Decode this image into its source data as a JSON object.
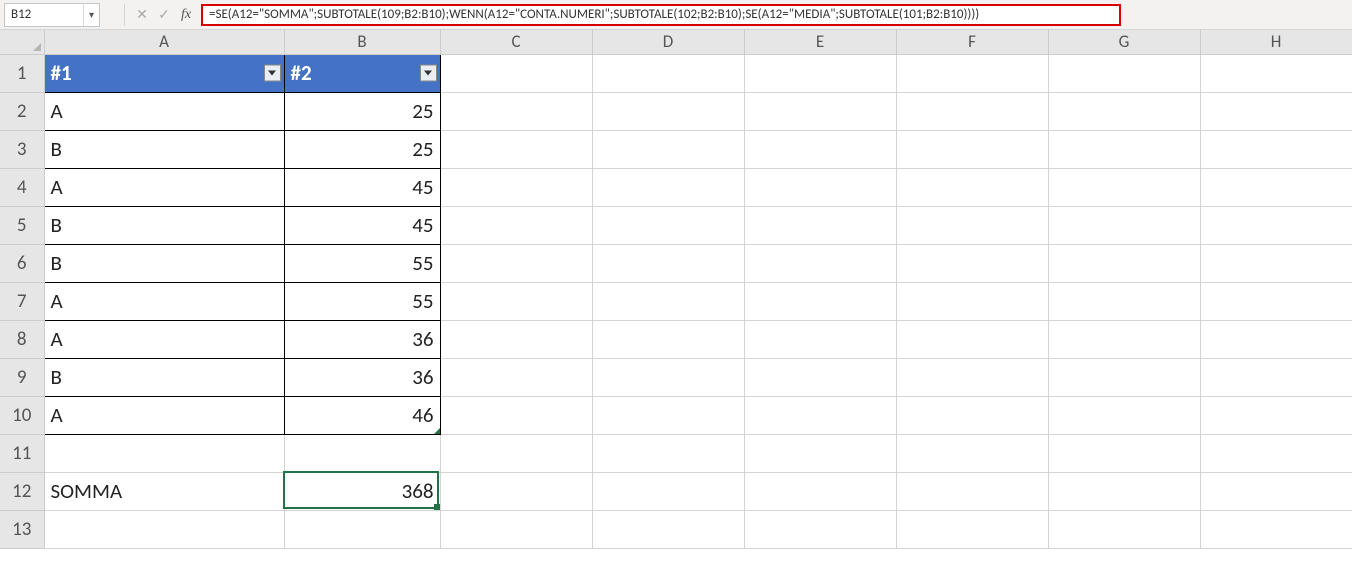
{
  "name_box": "B12",
  "formula": "=SE(A12=\"SOMMA\";SUBTOTALE(109;B2:B10);WENN(A12=\"CONTA.NUMERI\";SUBTOTALE(102;B2:B10);SE(A12=\"MEDIA\";SUBTOTALE(101;B2:B10))))",
  "columns": [
    "A",
    "B",
    "C",
    "D",
    "E",
    "F",
    "G",
    "H"
  ],
  "row_numbers": [
    "1",
    "2",
    "3",
    "4",
    "5",
    "6",
    "7",
    "8",
    "9",
    "10",
    "11",
    "12",
    "13"
  ],
  "table": {
    "headers": {
      "c1": "#1",
      "c2": "#2"
    },
    "rows": [
      {
        "c1": "A",
        "c2": "25"
      },
      {
        "c1": "B",
        "c2": "25"
      },
      {
        "c1": "A",
        "c2": "45"
      },
      {
        "c1": "B",
        "c2": "45"
      },
      {
        "c1": "B",
        "c2": "55"
      },
      {
        "c1": "A",
        "c2": "55"
      },
      {
        "c1": "A",
        "c2": "36"
      },
      {
        "c1": "B",
        "c2": "36"
      },
      {
        "c1": "A",
        "c2": "46"
      }
    ]
  },
  "summary": {
    "label": "SOMMA",
    "value": "368"
  },
  "selected_cell": "B12"
}
